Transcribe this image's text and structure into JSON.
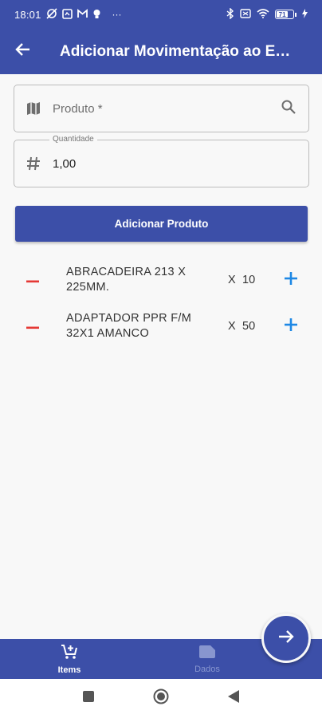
{
  "status_bar": {
    "time": "18:01",
    "left_icons": [
      "sync-off-icon",
      "square-app-icon",
      "gmail-icon",
      "bulb-icon"
    ],
    "more": "···",
    "battery_level": "71"
  },
  "app_bar": {
    "title": "Adicionar Movimentação ao Estoque"
  },
  "form": {
    "produto": {
      "placeholder": "Produto *"
    },
    "quantidade": {
      "label": "Quantidade",
      "value": "1,00"
    }
  },
  "add_button": {
    "label": "Adicionar Produto"
  },
  "items": [
    {
      "name": "ABRACADEIRA 213 X 225MM.",
      "x": "X",
      "qty": "10"
    },
    {
      "name": "ADAPTADOR PPR F/M 32X1 AMANCO",
      "x": "X",
      "qty": "50"
    }
  ],
  "bottom_nav": {
    "tabs": [
      {
        "label": "Items",
        "icon": "cart-add-icon",
        "active": true
      },
      {
        "label": "Dados",
        "icon": "folder-icon",
        "active": false
      }
    ]
  },
  "fab": {
    "icon": "arrow-forward-icon"
  },
  "colors": {
    "primary": "#3c4fa8",
    "remove": "#e53935",
    "add": "#1e88e5"
  }
}
